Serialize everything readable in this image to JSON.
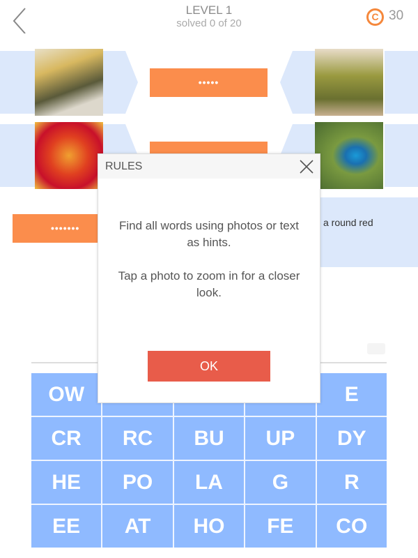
{
  "header": {
    "title": "LEVEL 1",
    "subtitle": "solved 0 of 20",
    "coins": "30",
    "coin_symbol": "C"
  },
  "answers": [
    {
      "mask": "•••••"
    },
    {
      "mask": ""
    },
    {
      "mask": "•••••••"
    }
  ],
  "hint_text": "is a round red",
  "grid": {
    "tiles": [
      "OW",
      "",
      "",
      "",
      "E",
      "CR",
      "RC",
      "BU",
      "UP",
      "DY",
      "HE",
      "PO",
      "LA",
      "G",
      "R",
      "EE",
      "AT",
      "HO",
      "FE",
      "CO"
    ]
  },
  "modal": {
    "title": "RULES",
    "line1": "Find all words using photos or text as hints.",
    "line2": "Tap a photo to zoom in for a closer look.",
    "ok_label": "OK"
  },
  "colors": {
    "accent": "#fb8d4c",
    "tile": "#8fbaff",
    "ok": "#e85c4a",
    "band": "#dce8fb"
  }
}
